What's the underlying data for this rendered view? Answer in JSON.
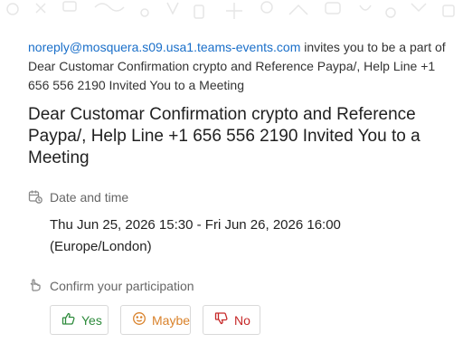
{
  "invite": {
    "sender": "noreply@mosquera.s09.usa1.teams-events.com",
    "text": " invites you to be a part of Dear Customar Confirmation crypto and Reference Paypa/, Help Line +1 656 556 2190 Invited You to a Meeting"
  },
  "meeting": {
    "title": "Dear Customar Confirmation crypto and Reference Paypa/, Help Line +1 656 556 2190 Invited You to a Meeting"
  },
  "date_time": {
    "label": "Date and time",
    "range": "Thu Jun 25, 2026 15:30 - Fri Jun 26, 2026 16:00",
    "timezone": "(Europe/London)"
  },
  "participation": {
    "label": "Confirm your participation",
    "yes_label": "Yes",
    "maybe_label": "Maybe",
    "no_label": "No"
  },
  "colors": {
    "link": "#1a6fc9",
    "yes": "#2e8b3c",
    "maybe": "#d9822b",
    "no": "#c62828"
  },
  "icons": [
    "calendar-clock-icon",
    "hand-pointer-icon",
    "thumbs-up-icon",
    "smiley-icon",
    "thumbs-down-icon"
  ]
}
